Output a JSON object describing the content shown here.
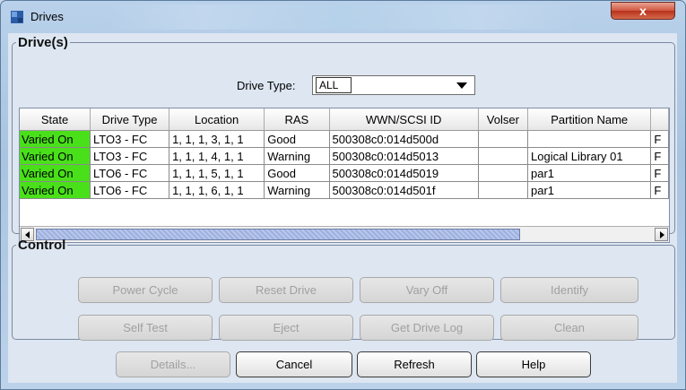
{
  "window": {
    "title": "Drives",
    "close_label": "x"
  },
  "drives_group": {
    "legend": "Drive(s)",
    "drive_type_label": "Drive Type:",
    "drive_type_value": "ALL"
  },
  "table": {
    "headers": [
      "State",
      "Drive Type",
      "Location",
      "RAS",
      "WWN/SCSI ID",
      "Volser",
      "Partition Name",
      ""
    ],
    "rows": [
      [
        "Varied On",
        "LTO3 - FC",
        "1, 1, 1, 3, 1, 1",
        "Good",
        "500308c0:014d500d",
        "",
        "",
        "F"
      ],
      [
        "Varied On",
        "LTO3 - FC",
        "1, 1, 1, 4, 1, 1",
        "Warning",
        "500308c0:014d5013",
        "",
        "Logical Library 01",
        "F"
      ],
      [
        "Varied On",
        "LTO6 - FC",
        "1, 1, 1, 5, 1, 1",
        "Good",
        "500308c0:014d5019",
        "",
        "par1",
        "F"
      ],
      [
        "Varied On",
        "LTO6 - FC",
        "1, 1, 1, 6, 1, 1",
        "Warning",
        "500308c0:014d501f",
        "",
        "par1",
        "F"
      ]
    ],
    "state_color": "#49e01a"
  },
  "control_group": {
    "legend": "Control",
    "buttons_row1": [
      "Power Cycle",
      "Reset Drive",
      "Vary Off",
      "Identify"
    ],
    "buttons_row2": [
      "Self Test",
      "Eject",
      "Get Drive Log",
      "Clean"
    ]
  },
  "footer": {
    "details": "Details...",
    "cancel": "Cancel",
    "refresh": "Refresh",
    "help": "Help"
  },
  "icons": {
    "app": "drives-app-icon",
    "close": "close-icon",
    "dropdown": "chevron-down-icon"
  }
}
